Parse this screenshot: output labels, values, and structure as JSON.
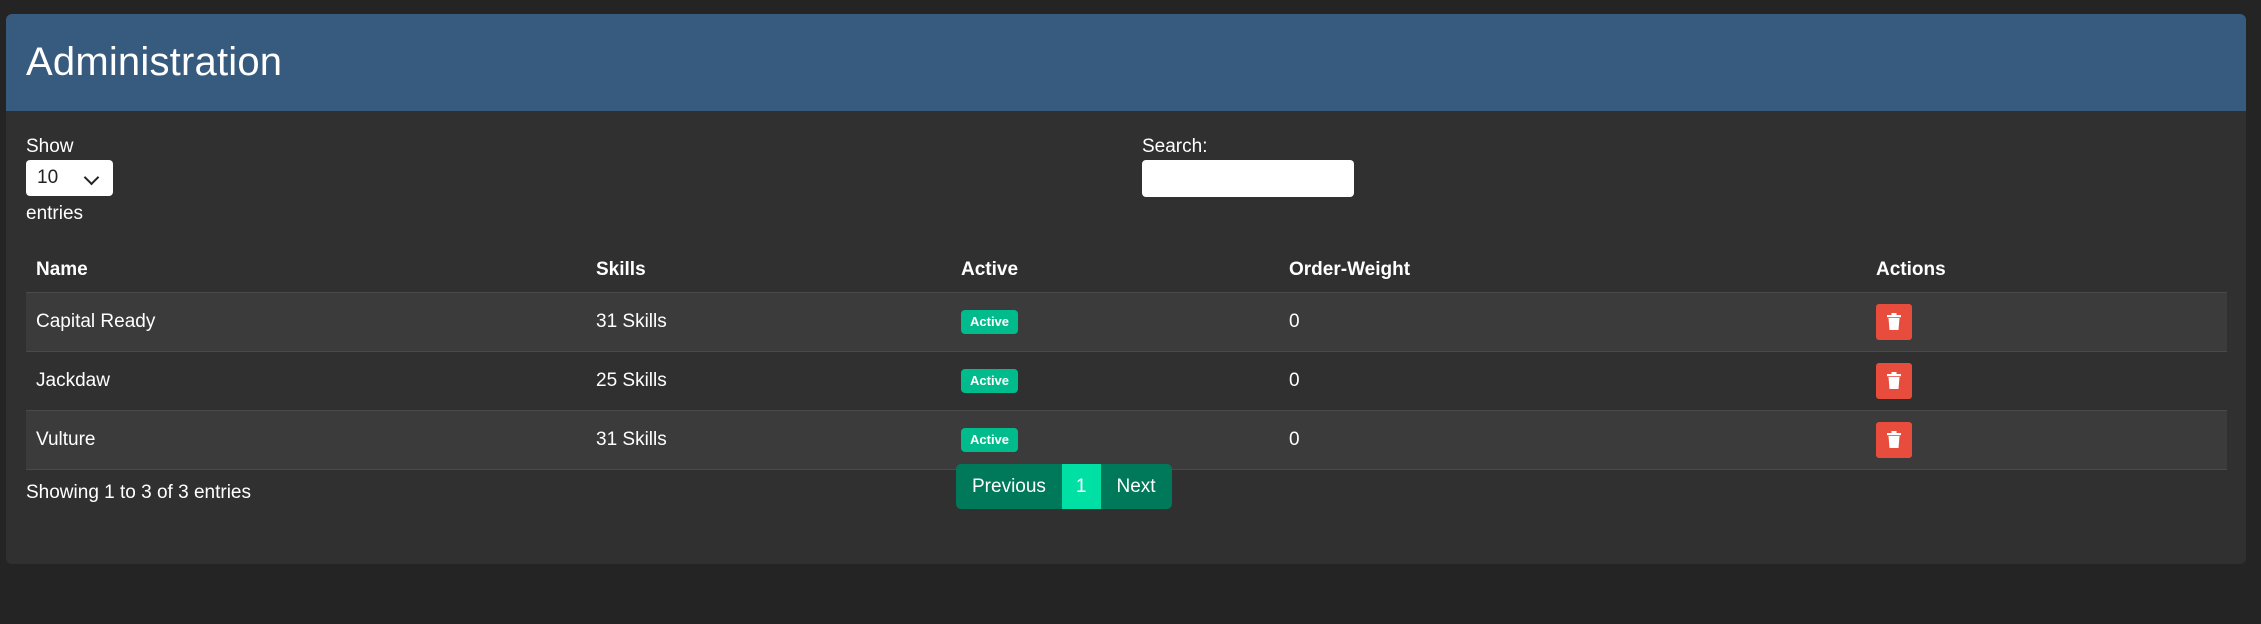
{
  "header": {
    "title": "Administration"
  },
  "length": {
    "show_label": "Show",
    "selected": "10",
    "entries_label": "entries"
  },
  "search": {
    "label": "Search:",
    "value": "",
    "placeholder": ""
  },
  "table": {
    "columns": [
      "Name",
      "Skills",
      "Active",
      "Order-Weight",
      "Actions"
    ],
    "rows": [
      {
        "name": "Capital Ready",
        "skills": "31 Skills",
        "active": "Active",
        "order_weight": "0"
      },
      {
        "name": "Jackdaw",
        "skills": "25 Skills",
        "active": "Active",
        "order_weight": "0"
      },
      {
        "name": "Vulture",
        "skills": "31 Skills",
        "active": "Active",
        "order_weight": "0"
      }
    ]
  },
  "footer": {
    "info": "Showing 1 to 3 of 3 entries",
    "pagination": {
      "previous": "Previous",
      "current_page": "1",
      "next": "Next"
    }
  },
  "icons": {
    "delete": "trash-icon",
    "dropdown": "chevron-down-icon"
  },
  "colors": {
    "header_bg": "#375a7f",
    "badge": "#00bc8c",
    "delete": "#e74c3c",
    "pager": "#00795a",
    "pager_active": "#00e0a4"
  }
}
